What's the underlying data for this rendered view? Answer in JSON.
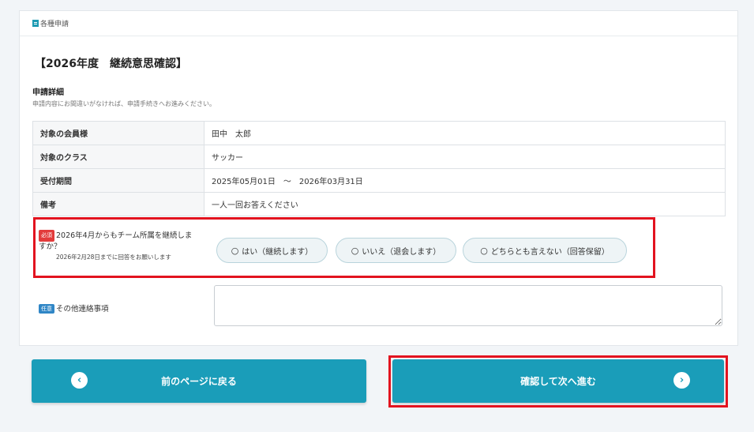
{
  "panel": {
    "header_label": "各種申請",
    "title": "【2026年度　継続意思確認】",
    "section_title": "申請詳細",
    "section_note": "申請内容にお間違いがなければ、申請手続きへお進みください。"
  },
  "details": [
    {
      "label": "対象の会員様",
      "value": "田中　太郎"
    },
    {
      "label": "対象のクラス",
      "value": "サッカー"
    },
    {
      "label": "受付期間",
      "value": "2025年05月01日　～　2026年03月31日"
    },
    {
      "label": "備考",
      "value": "一人一回お答えください"
    }
  ],
  "question": {
    "required_badge": "必須",
    "text": "2026年4月からもチーム所属を継続しますか？",
    "subtext": "2026年2月28日までに回答をお願いします",
    "options": [
      {
        "label": "はい（継続します）"
      },
      {
        "label": "いいえ（退会します）"
      },
      {
        "label": "どちらとも言えない（回答保留）"
      }
    ]
  },
  "other": {
    "optional_badge": "任意",
    "label": "その他連絡事項",
    "value": ""
  },
  "nav": {
    "back_label": "前のページに戻る",
    "next_label": "確認して次へ進む"
  },
  "colors": {
    "accent": "#1a9db9",
    "highlight": "#e2131f",
    "required": "#e23b3b",
    "optional": "#2f86c6"
  }
}
